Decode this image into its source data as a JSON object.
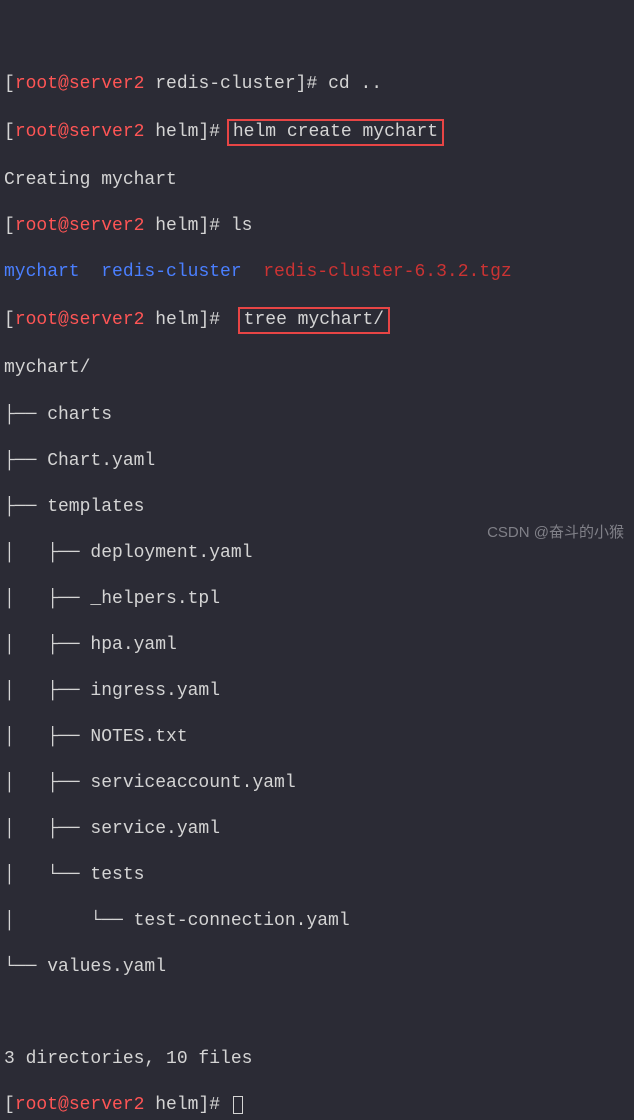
{
  "line1": {
    "prefix": "[",
    "user": "root@server2",
    "path": " redis-cluster",
    "suffix": "]# ",
    "cmd": "cd .."
  },
  "line2": {
    "prefix": "[",
    "user": "root@server2",
    "path": " helm",
    "suffix": "]# ",
    "cmd": "helm create mychart"
  },
  "line3": "Creating mychart",
  "line4": {
    "prefix": "[",
    "user": "root@server2",
    "path": " helm",
    "suffix": "]# ",
    "cmd": "ls"
  },
  "line5": {
    "a": "mychart",
    "b": "  redis-cluster",
    "c": "  redis-cluster-6.3.2.tgz"
  },
  "line6": {
    "prefix": "[",
    "user": "root@server2",
    "path": " helm",
    "suffix": "]# ",
    "cmd": "tree mychart/"
  },
  "tree": {
    "root": "mychart/",
    "l1": "├── charts",
    "l2": "├── Chart.yaml",
    "l3": "├── templates",
    "l4": "│   ├── deployment.yaml",
    "l5": "│   ├── _helpers.tpl",
    "l6": "│   ├── hpa.yaml",
    "l7": "│   ├── ingress.yaml",
    "l8": "│   ├── NOTES.txt",
    "l9": "│   ├── serviceaccount.yaml",
    "l10": "│   ├── service.yaml",
    "l11": "│   └── tests",
    "l12": "│       └── test-connection.yaml",
    "l13": "└── values.yaml"
  },
  "summary": "3 directories, 10 files",
  "final": {
    "prefix": "[",
    "user": "root@server2",
    "path": " helm",
    "suffix": "]# "
  },
  "watermark": "CSDN @奋斗的小猴"
}
